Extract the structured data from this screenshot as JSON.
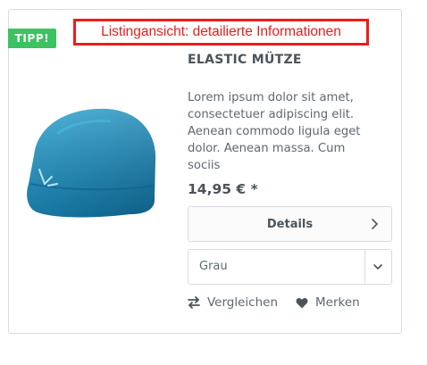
{
  "badge": {
    "label": "TIPP!"
  },
  "annotation": {
    "text": "Listingansicht: detailierte Informationen"
  },
  "product": {
    "title": "ELASTIC MÜTZE",
    "description": "Lorem ipsum dolor sit amet, consectetuer adipiscing elit. Aenean commodo ligula eget dolor. Aenean massa. Cum sociis",
    "price": "14,95 € *"
  },
  "details_button": {
    "label": "Details"
  },
  "variant_select": {
    "selected": "Grau"
  },
  "actions": {
    "compare_label": "Vergleichen",
    "remember_label": "Merken"
  },
  "colors": {
    "badge": "#3cc261",
    "annotation": "#ee1c1c",
    "product": "#1e8ab8"
  },
  "icons": {
    "details": "chevron-right-icon",
    "select": "chevron-down-icon",
    "compare": "arrows-swap-icon",
    "remember": "heart-icon"
  }
}
